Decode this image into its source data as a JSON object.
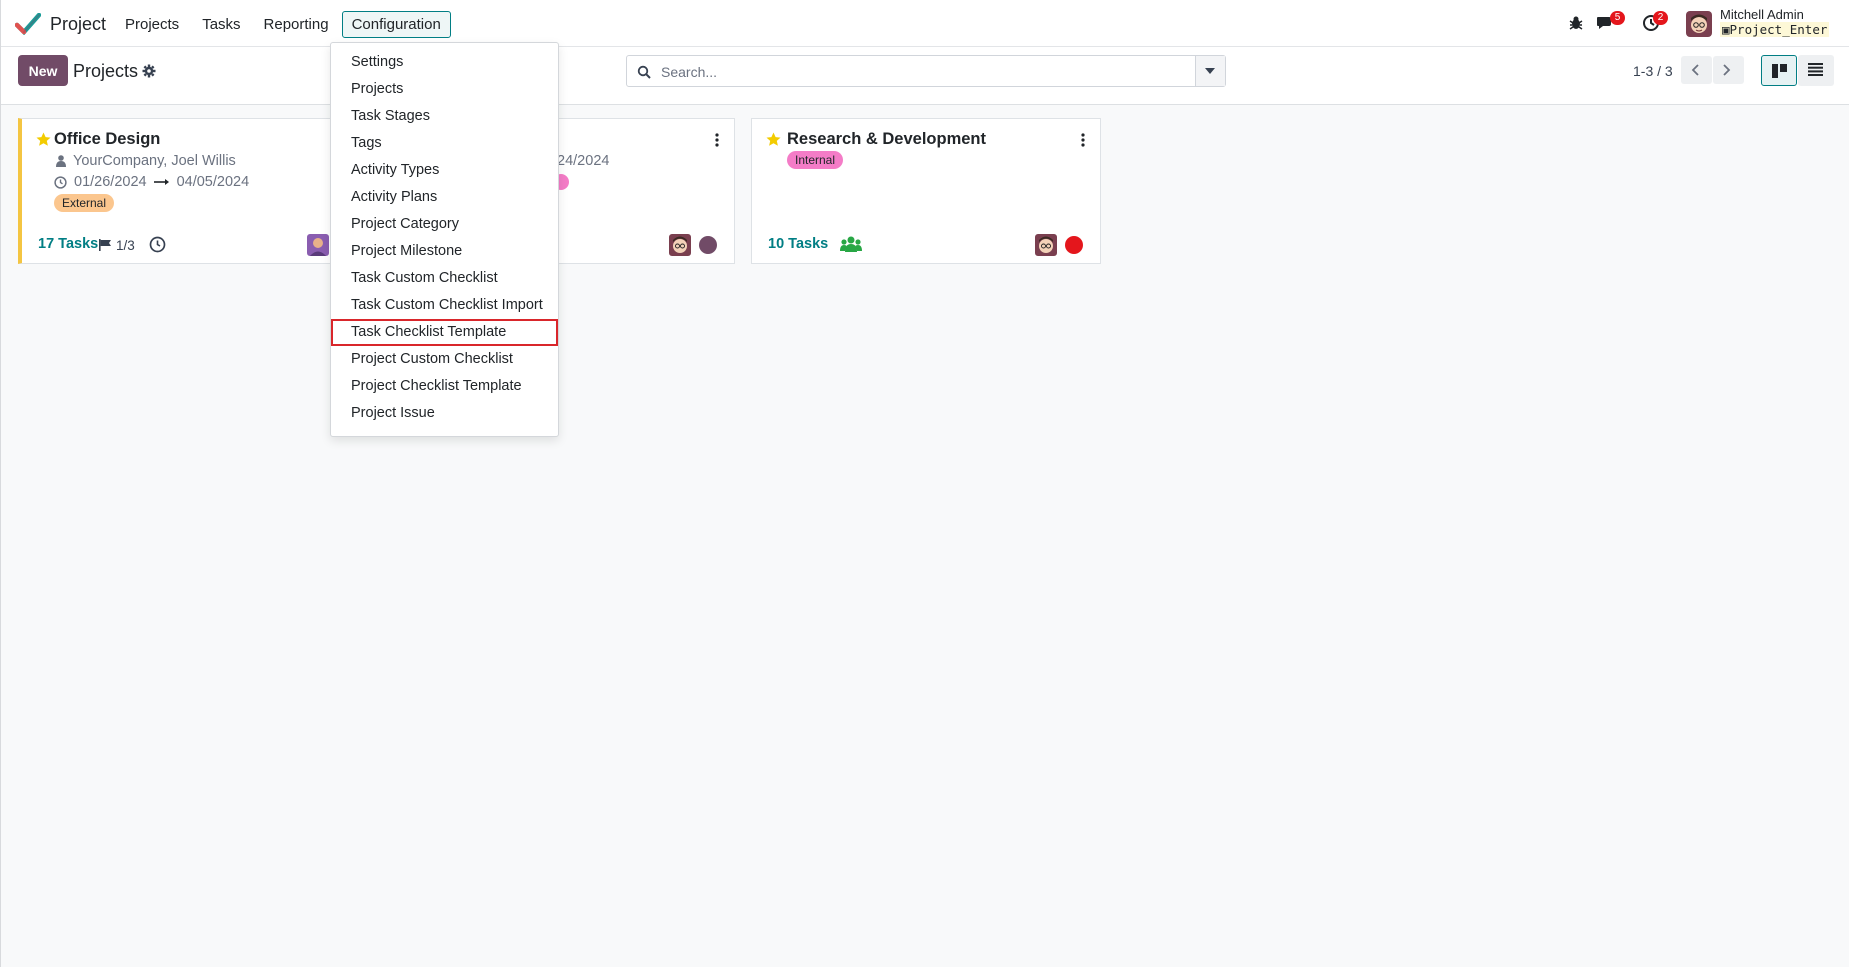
{
  "app": {
    "name": "Project"
  },
  "nav": {
    "menu": [
      {
        "label": "Projects"
      },
      {
        "label": "Tasks"
      },
      {
        "label": "Reporting"
      },
      {
        "label": "Configuration",
        "active": true
      }
    ]
  },
  "systray": {
    "messages_badge": "5",
    "activities_badge": "2",
    "user_name": "Mitchell Admin",
    "database": "Project_Enter"
  },
  "control": {
    "new_label": "New",
    "breadcrumb": "Projects",
    "search_placeholder": "Search...",
    "pager": "1-3 / 3"
  },
  "config_menu": {
    "items": [
      "Settings",
      "Projects",
      "Task Stages",
      "Tags",
      "Activity Types",
      "Activity Plans",
      "Project Category",
      "Project Milestone",
      "Task Custom Checklist",
      "Task Custom Checklist Import",
      "Task Checklist Template",
      "Project Custom Checklist",
      "Project Checklist Template",
      "Project Issue"
    ],
    "highlighted_index": 10
  },
  "cards": [
    {
      "title": "Office Design",
      "customer": "YourCompany, Joel Willis",
      "date_start": "01/26/2024",
      "date_end": "04/05/2024",
      "tag": "External",
      "tasks": "17 Tasks",
      "milestones": "1/3"
    },
    {
      "date_end_partial": "/24/2024"
    },
    {
      "title": "Research & Development",
      "tag": "Internal",
      "tasks": "10 Tasks"
    }
  ],
  "colors": {
    "brand": "#714b67",
    "accent": "#017e84",
    "highlight_border": "#d9262b",
    "tag_external": "#fbc68e",
    "tag_internal": "#f47cc7",
    "status_red": "#e4161c"
  }
}
